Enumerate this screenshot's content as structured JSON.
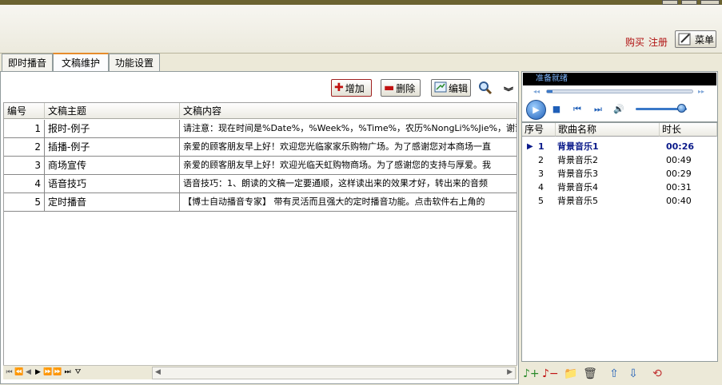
{
  "top": {
    "buy_label": "购买",
    "register_label": "注册",
    "menu_label": "菜单"
  },
  "tabs": [
    {
      "label": "即时播音"
    },
    {
      "label": "文稿维护"
    },
    {
      "label": "功能设置"
    }
  ],
  "toolbar": {
    "add_label": "增加",
    "delete_label": "删除",
    "edit_label": "编辑"
  },
  "grid": {
    "columns": [
      "编号",
      "文稿主题",
      "文稿内容"
    ],
    "rows": [
      {
        "id": "1",
        "title": "报时-例子",
        "content": "请注意：现在时间是%Date%，%Week%，%Time%，农历%NongLi%%Jie%，谢谢您的"
      },
      {
        "id": "2",
        "title": "插播-例子",
        "content": "亲爱的顾客朋友早上好！欢迎您光临家家乐购物广场。为了感谢您对本商场一直"
      },
      {
        "id": "3",
        "title": "商场宣传",
        "content": "亲爱的顾客朋友早上好！欢迎光临天虹购物商场。为了感谢您的支持与厚爱。我"
      },
      {
        "id": "4",
        "title": "语音技巧",
        "content": "语音技巧：1、朗读的文稿一定要通顺，这样读出来的效果才好，转出来的音频"
      },
      {
        "id": "5",
        "title": "定时播音",
        "content": "【博士自动播音专家】 带有灵活而且强大的定时播音功能。点击软件右上角的"
      }
    ]
  },
  "player": {
    "status": "准备就绪",
    "seek_progress": 0.04,
    "volume": 0.9
  },
  "playlist": {
    "columns": [
      "序号",
      "歌曲名称",
      "时长"
    ],
    "rows": [
      {
        "no": "1",
        "name": "背景音乐1",
        "duration": "00:26",
        "active": true
      },
      {
        "no": "2",
        "name": "背景音乐2",
        "duration": "00:49",
        "active": false
      },
      {
        "no": "3",
        "name": "背景音乐3",
        "duration": "00:29",
        "active": false
      },
      {
        "no": "4",
        "name": "背景音乐4",
        "duration": "00:31",
        "active": false
      },
      {
        "no": "5",
        "name": "背景音乐5",
        "duration": "00:40",
        "active": false
      }
    ]
  },
  "colors": {
    "accent_blue": "#1f5fb8",
    "link_red": "#b01010",
    "active_tab": "#e68b2c"
  }
}
